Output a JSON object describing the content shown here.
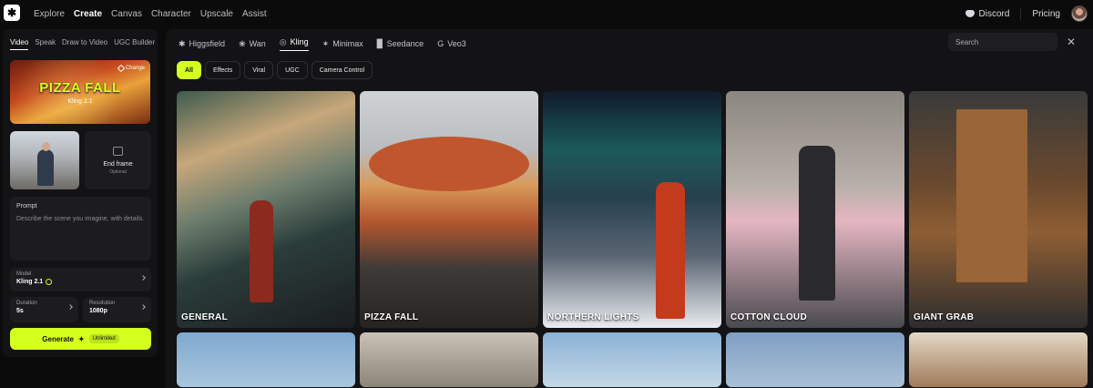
{
  "top_nav": {
    "logo_icon": "higgsfield-logo-icon",
    "items": [
      "Explore",
      "Create",
      "Canvas",
      "Character",
      "Upscale",
      "Assist"
    ],
    "active": "Create",
    "discord_label": "Discord",
    "pricing_label": "Pricing"
  },
  "left_panel": {
    "subtabs": [
      "Video",
      "Speak",
      "Draw to Video",
      "UGC Builder"
    ],
    "active_subtab": "Video",
    "preset": {
      "title": "PIZZA FALL",
      "subtitle": "Kling 2.1",
      "change_label": "Change"
    },
    "end_frame": {
      "label": "End frame",
      "sub": "Optional"
    },
    "prompt": {
      "label": "Prompt",
      "placeholder": "Describe the scene you imagine, with details."
    },
    "model": {
      "label": "Model",
      "value": "Kling 2.1"
    },
    "duration": {
      "label": "Duration",
      "value": "5s"
    },
    "resolution": {
      "label": "Resolution",
      "value": "1080p"
    },
    "generate": {
      "label": "Generate",
      "badge": "Unlimited"
    }
  },
  "content": {
    "model_tabs": [
      {
        "label": "Higgsfield",
        "icon": "higgsfield-icon"
      },
      {
        "label": "Wan",
        "icon": "wan-icon"
      },
      {
        "label": "Kling",
        "icon": "kling-icon"
      },
      {
        "label": "Minimax",
        "icon": "minimax-icon"
      },
      {
        "label": "Seedance",
        "icon": "seedance-icon"
      },
      {
        "label": "Veo3",
        "icon": "google-icon"
      }
    ],
    "active_model_tab": "Kling",
    "search_placeholder": "Search",
    "filters": [
      "All",
      "Effects",
      "Viral",
      "UGC",
      "Camera Control"
    ],
    "active_filter": "All",
    "tiles": [
      "GENERAL",
      "PIZZA FALL",
      "NORTHERN LIGHTS",
      "COTTON CLOUD",
      "GIANT GRAB"
    ]
  },
  "colors": {
    "accent": "#d4ff1f",
    "panel": "#131315",
    "background": "#0b0b0c"
  }
}
